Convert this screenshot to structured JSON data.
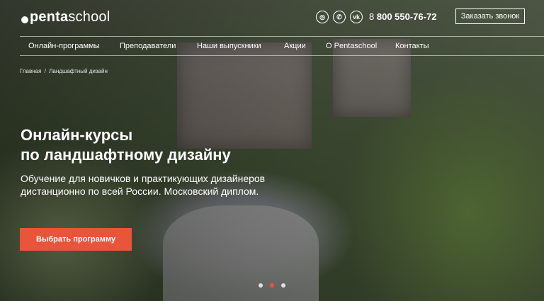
{
  "brand": {
    "logo_bold": "penta",
    "logo_light": "school"
  },
  "header": {
    "socials": [
      {
        "icon": "instagram-icon",
        "glyph": "◎"
      },
      {
        "icon": "whatsapp-icon",
        "glyph": "✆"
      },
      {
        "icon": "vk-icon",
        "glyph": "vk"
      }
    ],
    "phone_prefix": "8",
    "phone_number": "800 550-76-72",
    "callback_label": "Заказать звонок"
  },
  "nav": {
    "items": [
      {
        "label": "Онлайн-программы"
      },
      {
        "label": "Преподаватели"
      },
      {
        "label": "Наши выпускники"
      },
      {
        "label": "Акции"
      },
      {
        "label": "О Pentaschool"
      },
      {
        "label": "Контакты"
      }
    ]
  },
  "breadcrumbs": {
    "home": "Главная",
    "separator": "/",
    "current": "Ландшафтный дизайн"
  },
  "hero": {
    "title_line1": "Онлайн-курсы",
    "title_line2": "по ландшафтному дизайну",
    "subtitle_line1": "Обучение для новичков и практикующих дизайнеров",
    "subtitle_line2": "дистанционно по всей России. Московский диплом.",
    "cta_label": "Выбрать программу"
  },
  "slider": {
    "count": 3,
    "active_index": 1
  },
  "colors": {
    "accent": "#e8553b",
    "text": "#ffffff"
  }
}
